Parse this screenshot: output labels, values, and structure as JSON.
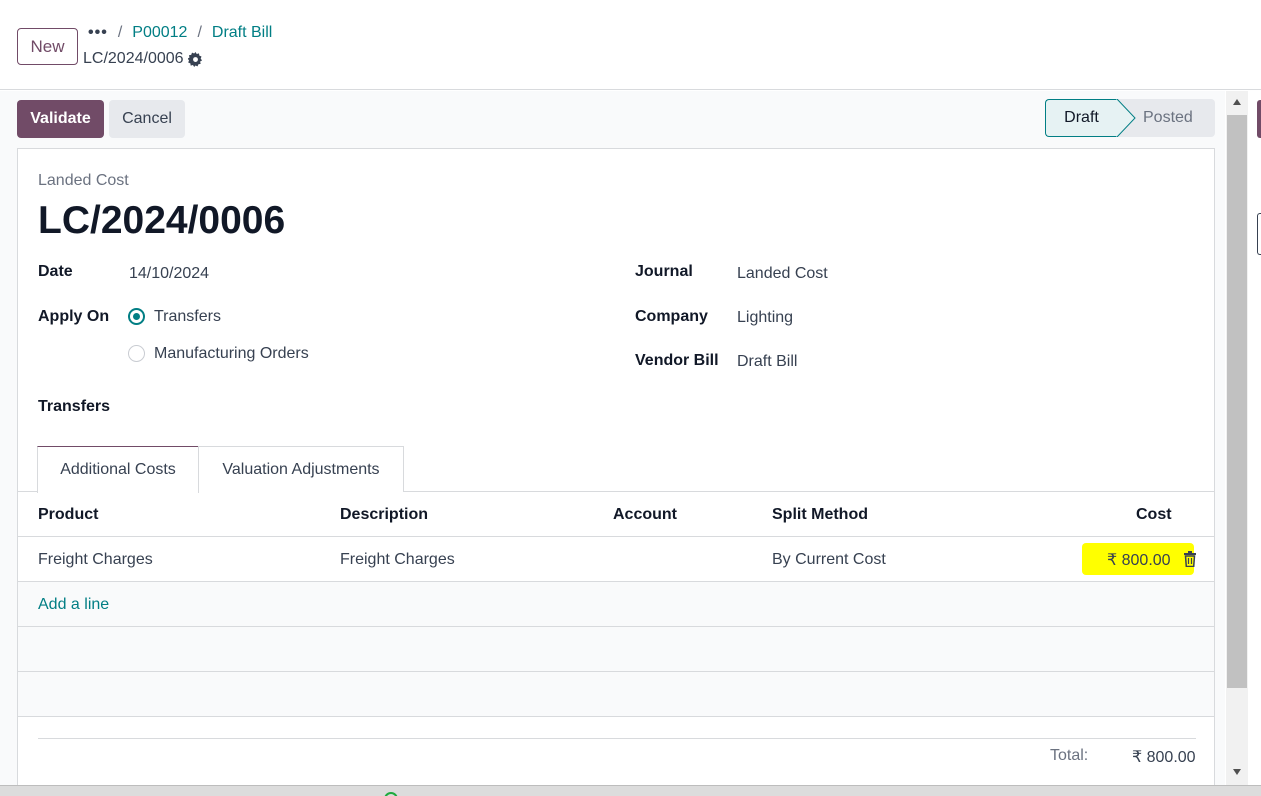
{
  "control_panel": {
    "new_label": "New",
    "breadcrumb_more": "•••",
    "breadcrumbs": [
      "P00012",
      "Draft Bill"
    ],
    "separator": "/",
    "record_name": "LC/2024/0006"
  },
  "actions": {
    "validate_label": "Validate",
    "cancel_label": "Cancel"
  },
  "statusbar": {
    "states": [
      "Draft",
      "Posted"
    ],
    "current": "Draft"
  },
  "form": {
    "subtitle": "Landed Cost",
    "title": "LC/2024/0006",
    "date_label": "Date",
    "date_value": "14/10/2024",
    "apply_on_label": "Apply On",
    "apply_on_options": [
      "Transfers",
      "Manufacturing Orders"
    ],
    "apply_on_selected": "Transfers",
    "transfers_label": "Transfers",
    "journal_label": "Journal",
    "journal_value": "Landed Cost",
    "company_label": "Company",
    "company_value": "Lighting",
    "vendor_bill_label": "Vendor Bill",
    "vendor_bill_value": "Draft Bill"
  },
  "tabs": [
    "Additional Costs",
    "Valuation Adjustments"
  ],
  "active_tab": "Additional Costs",
  "costs_table": {
    "headers": [
      "Product",
      "Description",
      "Account",
      "Split Method",
      "Cost"
    ],
    "rows": [
      [
        "Freight Charges",
        "Freight Charges",
        "",
        "By Current Cost",
        "₹ 800.00"
      ]
    ],
    "add_line_label": "Add a line",
    "total_label": "Total:",
    "total_value": "₹ 800.00"
  },
  "colors": {
    "brand": "#714b67",
    "accent": "#017e84",
    "highlight": "#ffff00"
  },
  "icons": {
    "settings": "gear-icon",
    "delete": "trash-icon"
  }
}
